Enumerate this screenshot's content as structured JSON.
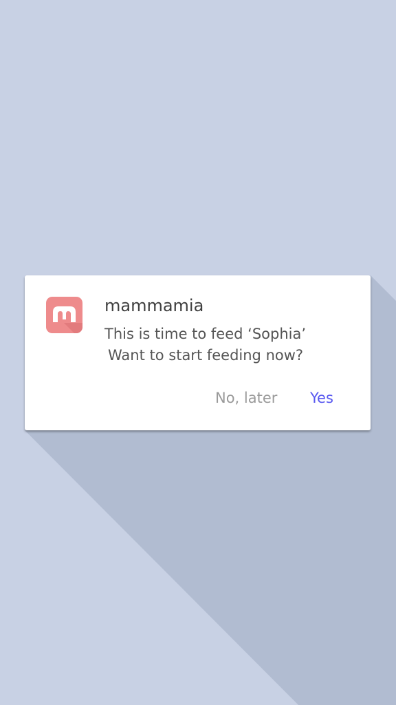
{
  "colors": {
    "background": "#c8d1e4",
    "long_shadow": "#b1bcd1",
    "dialog": "#ffffff",
    "brand": "#ee8b8c",
    "positive": "#5858f0",
    "negative": "#9a9a9a"
  },
  "notification": {
    "app_icon": "mammamia-logo-icon",
    "app_name": "mammamia",
    "message_line1": "This is time to feed ‘Sophia’",
    "message_line2": "Want to start feeding now?",
    "buttons": {
      "later": "No, later",
      "yes": "Yes"
    }
  }
}
